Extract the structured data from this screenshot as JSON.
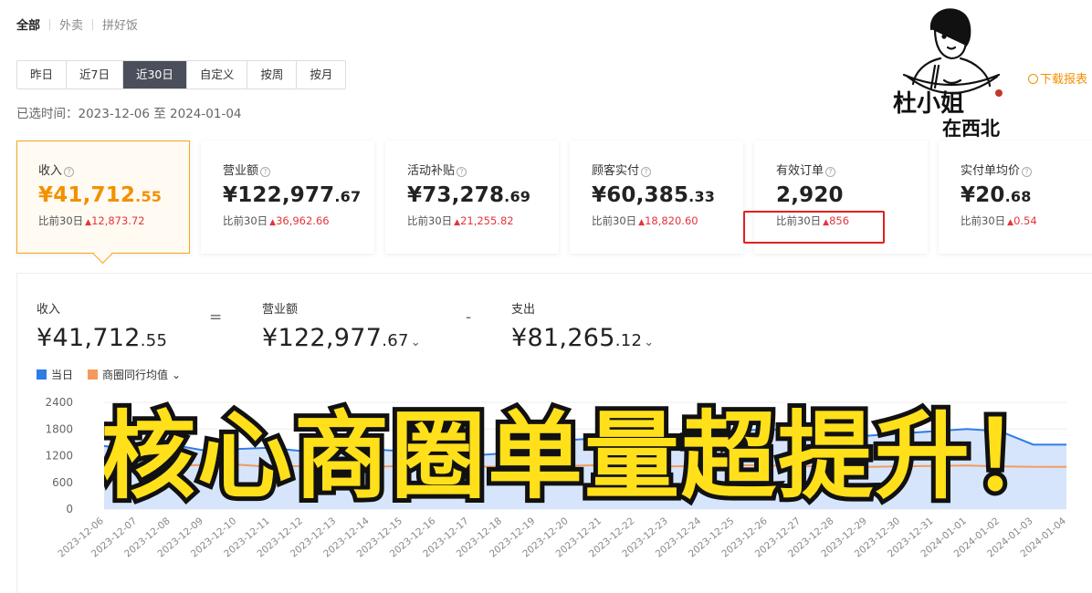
{
  "channels": [
    "全部",
    "外卖",
    "拼好饭"
  ],
  "range_buttons": [
    "昨日",
    "近7日",
    "近30日",
    "自定义",
    "按周",
    "按月"
  ],
  "selected_time": "已选时间：2023-12-06 至 2024-01-04",
  "download_label": "下载报表",
  "mascot": {
    "name": "杜小姐",
    "sub": "在西北"
  },
  "cards": [
    {
      "label": "收入",
      "int": "¥41,712",
      "dec": ".55",
      "cmp_label": "比前30日",
      "cmp_value": "12,873.72"
    },
    {
      "label": "营业额",
      "int": "¥122,977",
      "dec": ".67",
      "cmp_label": "比前30日",
      "cmp_value": "36,962.66"
    },
    {
      "label": "活动补贴",
      "int": "¥73,278",
      "dec": ".69",
      "cmp_label": "比前30日",
      "cmp_value": "21,255.82"
    },
    {
      "label": "顾客实付",
      "int": "¥60,385",
      "dec": ".33",
      "cmp_label": "比前30日",
      "cmp_value": "18,820.60"
    },
    {
      "label": "有效订单",
      "int": "2,920",
      "dec": "",
      "cmp_label": "比前30日",
      "cmp_value": "856"
    },
    {
      "label": "实付单均价",
      "int": "¥20",
      "dec": ".68",
      "cmp_label": "比前30日",
      "cmp_value": "0.54"
    }
  ],
  "formula": {
    "income_label": "收入",
    "income_int": "¥41,712",
    "income_dec": ".55",
    "eq": "=",
    "revenue_label": "营业额",
    "revenue_int": "¥122,977",
    "revenue_dec": ".67",
    "minus": "-",
    "expense_label": "支出",
    "expense_int": "¥81,265",
    "expense_dec": ".12"
  },
  "legend": {
    "series1": "当日",
    "series2": "商圈同行均值"
  },
  "overlay_text": "核心商圈单量超提升！",
  "colors": {
    "accent": "#f29100",
    "series1": "#2e7ce6",
    "series2": "#f39a5c",
    "up": "#e5343b"
  },
  "chart_data": {
    "type": "area",
    "x": [
      "2023-12-06",
      "2023-12-07",
      "2023-12-08",
      "2023-12-09",
      "2023-12-10",
      "2023-12-11",
      "2023-12-12",
      "2023-12-13",
      "2023-12-14",
      "2023-12-15",
      "2023-12-16",
      "2023-12-17",
      "2023-12-18",
      "2023-12-19",
      "2023-12-20",
      "2023-12-21",
      "2023-12-22",
      "2023-12-23",
      "2023-12-24",
      "2023-12-25",
      "2023-12-26",
      "2023-12-27",
      "2023-12-28",
      "2023-12-29",
      "2023-12-30",
      "2023-12-31",
      "2024-01-01",
      "2024-01-02",
      "2024-01-03",
      "2024-01-04"
    ],
    "yticks": [
      0,
      600,
      1200,
      1800,
      2400
    ],
    "ylim": [
      0,
      2400
    ],
    "series": [
      {
        "name": "当日",
        "values": [
          1420,
          1300,
          1450,
          1320,
          1350,
          1380,
          1300,
          1400,
          1350,
          1300,
          1400,
          1200,
          1250,
          1500,
          1550,
          1600,
          1650,
          1600,
          1700,
          1750,
          1800,
          1750,
          1700,
          1650,
          1700,
          1750,
          1800,
          1750,
          1450,
          1450
        ]
      },
      {
        "name": "商圈同行均值",
        "values": [
          1000,
          1020,
          980,
          990,
          1000,
          950,
          970,
          960,
          950,
          970,
          980,
          960,
          950,
          960,
          970,
          990,
          980,
          960,
          970,
          990,
          980,
          960,
          970,
          950,
          960,
          970,
          980,
          960,
          950,
          950
        ]
      }
    ]
  }
}
